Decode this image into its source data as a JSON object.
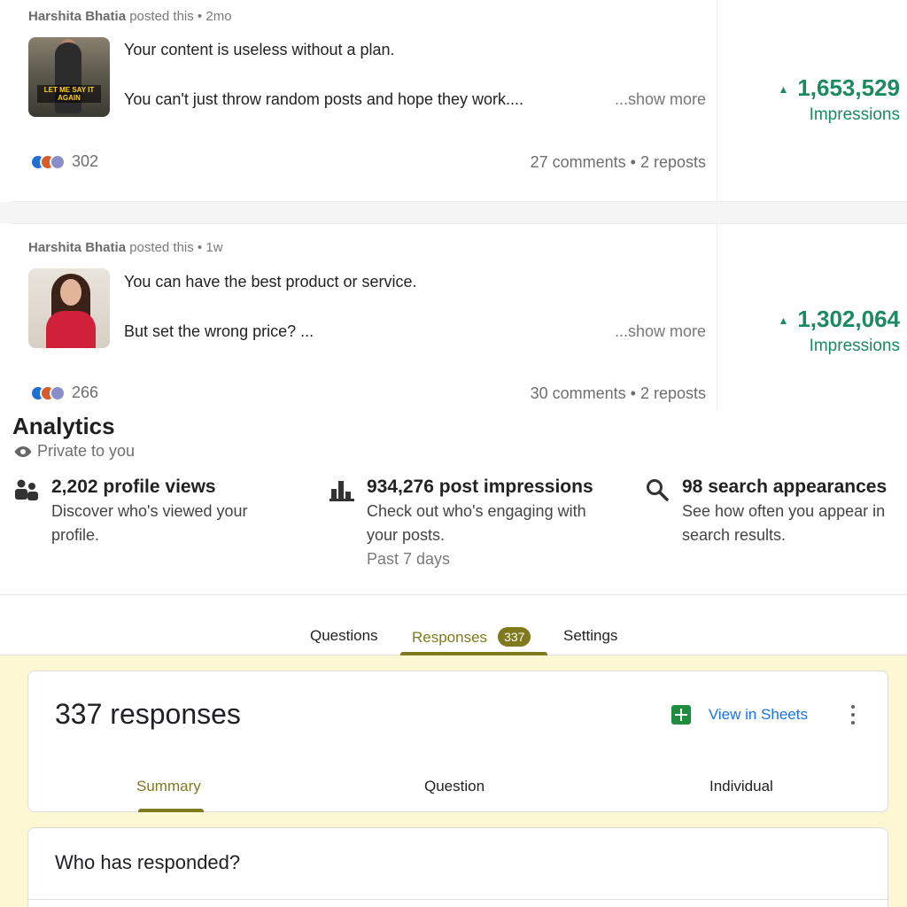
{
  "posts": [
    {
      "author": "Harshita Bhatia",
      "posted_suffix": "posted this • 2mo",
      "line1": "Your content is useless without a plan.",
      "line2": "You can't just throw random posts and hope they work....",
      "show_more": "...show more",
      "reaction_count": "302",
      "comments": "27 comments • 2 reposts",
      "impressions_value": "1,653,529",
      "impressions_label": "Impressions",
      "thumb_caption": "LET ME SAY IT AGAIN"
    },
    {
      "author": "Harshita Bhatia",
      "posted_suffix": "posted this • 1w",
      "line1": "You can have the best product or service.",
      "line2": "But set the wrong price? ...",
      "show_more": "...show more",
      "reaction_count": "266",
      "comments": "30 comments • 2 reposts",
      "impressions_value": "1,302,064",
      "impressions_label": "Impressions"
    }
  ],
  "analytics": {
    "title": "Analytics",
    "private": "Private to you",
    "cards": [
      {
        "icon": "people-icon",
        "head": "2,202 profile views",
        "desc": "Discover who's viewed your profile.",
        "sub": ""
      },
      {
        "icon": "bar-chart-icon",
        "head": "934,276 post impressions",
        "desc": "Check out who's engaging with your posts.",
        "sub": "Past 7 days"
      },
      {
        "icon": "search-icon",
        "head": "98 search appearances",
        "desc": "See how often you appear in search results.",
        "sub": ""
      }
    ]
  },
  "forms": {
    "tabs": {
      "questions": "Questions",
      "responses": "Responses",
      "responses_badge": "337",
      "settings": "Settings"
    },
    "response_count": "337 responses",
    "view_in_sheets": "View in Sheets",
    "subtabs": {
      "summary": "Summary",
      "question": "Question",
      "individual": "Individual"
    },
    "who_responded": "Who has responded?",
    "accent_color": "#7f7a1e",
    "background_color": "#fdf8d3"
  }
}
